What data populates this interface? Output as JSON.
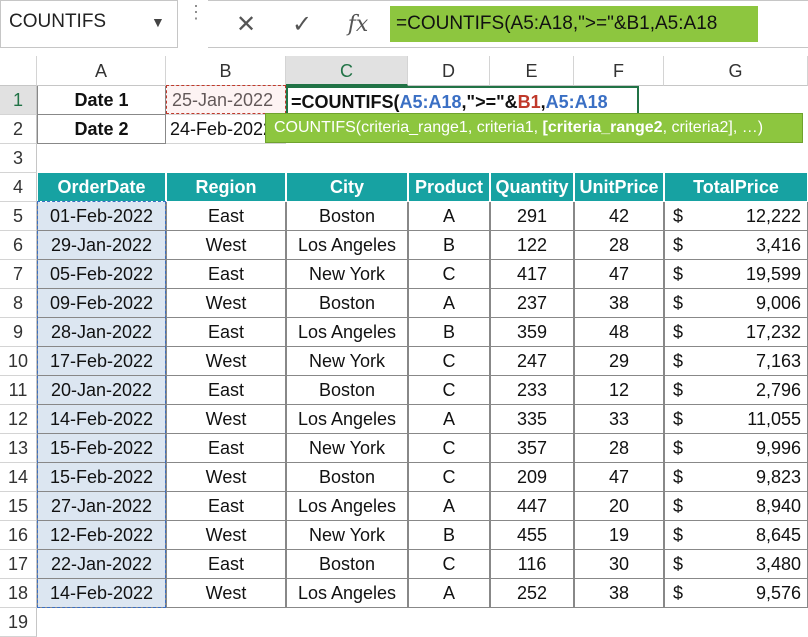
{
  "name_box": {
    "value": "COUNTIFS"
  },
  "formula_bar": {
    "cancel_symbol": "✕",
    "enter_symbol": "✓",
    "fx_symbol": "fx",
    "content": "=COUNTIFS(A5:A18,\">=\"&B1,A5:A18"
  },
  "columns": [
    "A",
    "B",
    "C",
    "D",
    "E",
    "F",
    "G"
  ],
  "rows": [
    "1",
    "2",
    "3",
    "4",
    "5",
    "6",
    "7",
    "8",
    "9",
    "10",
    "11",
    "12",
    "13",
    "14",
    "15",
    "16",
    "17",
    "18",
    "19"
  ],
  "cells": {
    "A1": "Date 1",
    "B1": "25-Jan-2022",
    "A2": "Date 2",
    "B2": "24-Feb-2022",
    "C1_parts": [
      "=COUNTIFS(",
      "A5:A18",
      ",\">=\"&",
      "B1",
      ",",
      "A5:A18"
    ]
  },
  "tooltip": {
    "prefix": "COUNTIFS(criteria_range1, criteria1, ",
    "bold_part": "[criteria_range2",
    "suffix": ", criteria2], …)"
  },
  "table": {
    "headers": [
      "OrderDate",
      "Region",
      "City",
      "Product",
      "Quantity",
      "UnitPrice",
      "TotalPrice"
    ],
    "currency": "$",
    "rows": [
      [
        "01-Feb-2022",
        "East",
        "Boston",
        "A",
        "291",
        "42",
        "12,222"
      ],
      [
        "29-Jan-2022",
        "West",
        "Los Angeles",
        "B",
        "122",
        "28",
        "3,416"
      ],
      [
        "05-Feb-2022",
        "East",
        "New York",
        "C",
        "417",
        "47",
        "19,599"
      ],
      [
        "09-Feb-2022",
        "West",
        "Boston",
        "A",
        "237",
        "38",
        "9,006"
      ],
      [
        "28-Jan-2022",
        "East",
        "Los Angeles",
        "B",
        "359",
        "48",
        "17,232"
      ],
      [
        "17-Feb-2022",
        "West",
        "New York",
        "C",
        "247",
        "29",
        "7,163"
      ],
      [
        "20-Jan-2022",
        "East",
        "Boston",
        "C",
        "233",
        "12",
        "2,796"
      ],
      [
        "14-Feb-2022",
        "West",
        "Los Angeles",
        "A",
        "335",
        "33",
        "11,055"
      ],
      [
        "15-Feb-2022",
        "East",
        "New York",
        "C",
        "357",
        "28",
        "9,996"
      ],
      [
        "15-Feb-2022",
        "West",
        "Boston",
        "C",
        "209",
        "47",
        "9,823"
      ],
      [
        "27-Jan-2022",
        "East",
        "Los Angeles",
        "A",
        "447",
        "20",
        "8,940"
      ],
      [
        "12-Feb-2022",
        "West",
        "New York",
        "B",
        "455",
        "19",
        "8,645"
      ],
      [
        "22-Jan-2022",
        "East",
        "Boston",
        "C",
        "116",
        "30",
        "3,480"
      ],
      [
        "14-Feb-2022",
        "West",
        "Los Angeles",
        "A",
        "252",
        "38",
        "9,576"
      ]
    ]
  },
  "colors": {
    "header_teal": "#17a2a2",
    "formula_green": "#8dc63f",
    "ref_blue": "#3a6fc4",
    "ref_red": "#c0392b"
  }
}
